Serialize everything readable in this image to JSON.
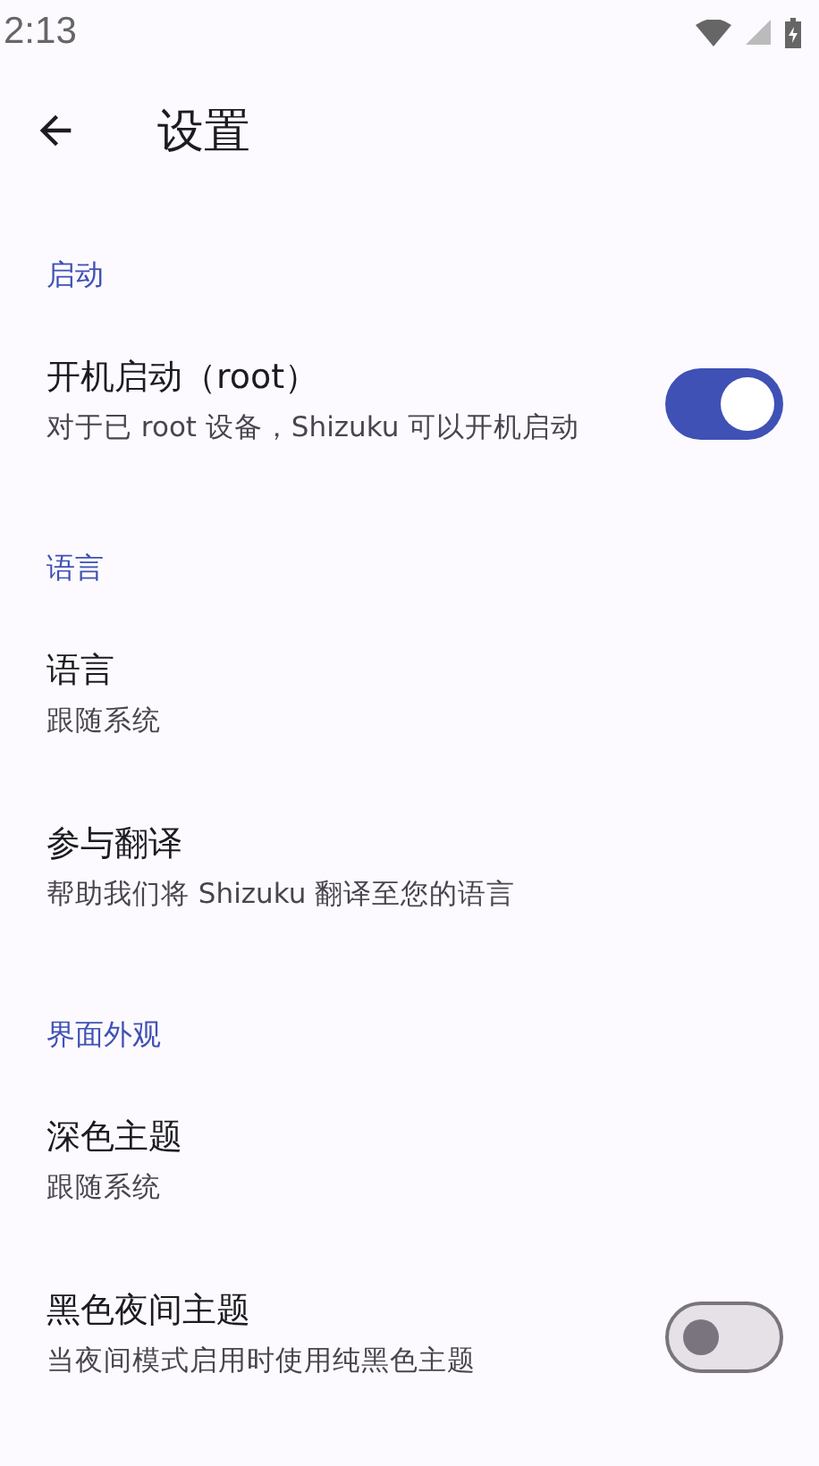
{
  "status_bar": {
    "time": "2:13"
  },
  "toolbar": {
    "title": "设置"
  },
  "sections": [
    {
      "header": "启动",
      "items": [
        {
          "kind": "switch",
          "title": "开机启动（root）",
          "summary": "对于已 root 设备，Shizuku 可以开机启动",
          "on": true
        }
      ]
    },
    {
      "header": "语言",
      "items": [
        {
          "kind": "text",
          "title": "语言",
          "summary": "跟随系统"
        },
        {
          "kind": "text",
          "title": "参与翻译",
          "summary": "帮助我们将 Shizuku 翻译至您的语言"
        }
      ]
    },
    {
      "header": "界面外观",
      "items": [
        {
          "kind": "text",
          "title": "深色主题",
          "summary": "跟随系统"
        },
        {
          "kind": "switch",
          "title": "黑色夜间主题",
          "summary": "当夜间模式启用时使用纯黑色主题",
          "on": false
        }
      ]
    }
  ]
}
